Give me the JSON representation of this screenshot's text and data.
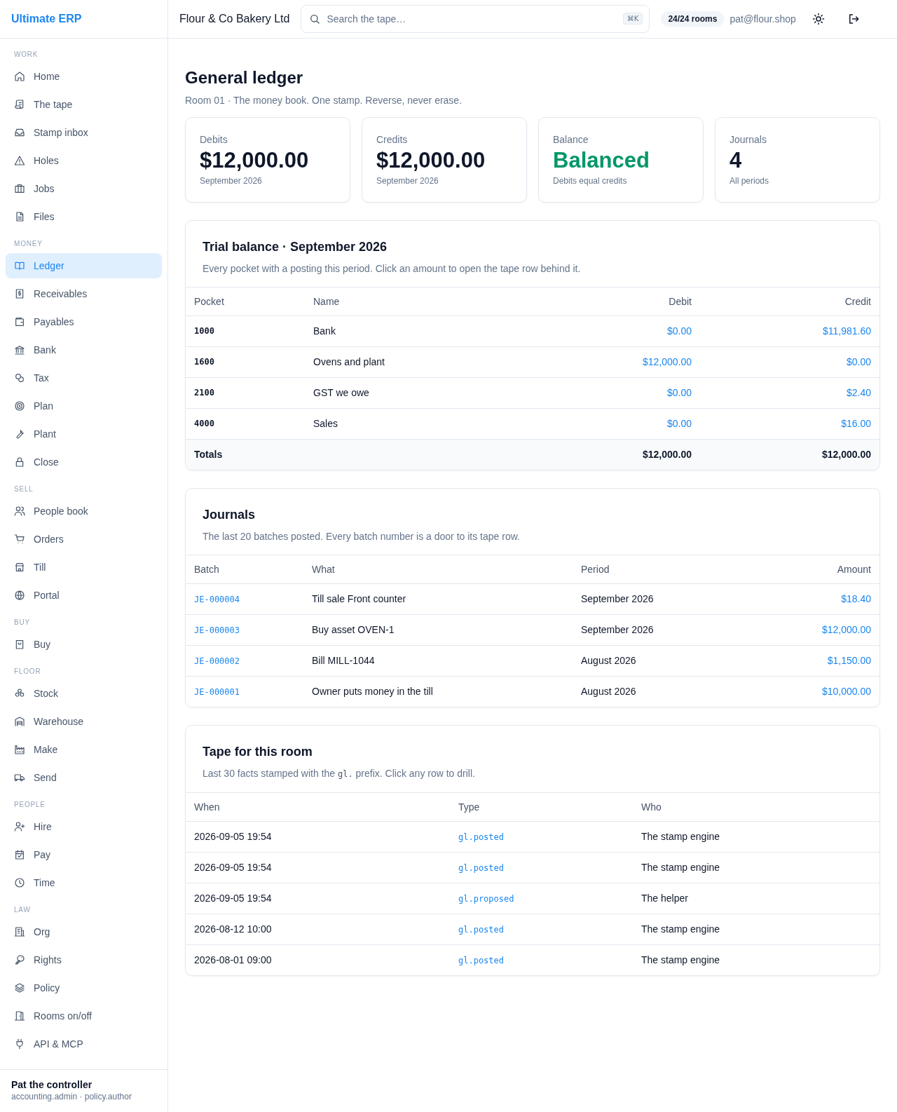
{
  "sidebar": {
    "brand": "Ultimate ERP",
    "sections": [
      {
        "label": "WORK",
        "items": [
          {
            "label": "Home",
            "selected": false
          },
          {
            "label": "The tape",
            "selected": false
          },
          {
            "label": "Stamp inbox",
            "selected": false
          },
          {
            "label": "Holes",
            "selected": false
          },
          {
            "label": "Jobs",
            "selected": false
          },
          {
            "label": "Files",
            "selected": false
          }
        ]
      },
      {
        "label": "MONEY",
        "items": [
          {
            "label": "Ledger",
            "selected": true
          },
          {
            "label": "Receivables",
            "selected": false
          },
          {
            "label": "Payables",
            "selected": false
          },
          {
            "label": "Bank",
            "selected": false
          },
          {
            "label": "Tax",
            "selected": false
          },
          {
            "label": "Plan",
            "selected": false
          },
          {
            "label": "Plant",
            "selected": false
          },
          {
            "label": "Close",
            "selected": false
          }
        ]
      },
      {
        "label": "SELL",
        "items": [
          {
            "label": "People book",
            "selected": false
          },
          {
            "label": "Orders",
            "selected": false
          },
          {
            "label": "Till",
            "selected": false
          },
          {
            "label": "Portal",
            "selected": false
          }
        ]
      },
      {
        "label": "BUY",
        "items": [
          {
            "label": "Buy",
            "selected": false
          }
        ]
      },
      {
        "label": "FLOOR",
        "items": [
          {
            "label": "Stock",
            "selected": false
          },
          {
            "label": "Warehouse",
            "selected": false
          },
          {
            "label": "Make",
            "selected": false
          },
          {
            "label": "Send",
            "selected": false
          }
        ]
      },
      {
        "label": "PEOPLE",
        "items": [
          {
            "label": "Hire",
            "selected": false
          },
          {
            "label": "Pay",
            "selected": false
          },
          {
            "label": "Time",
            "selected": false
          }
        ]
      },
      {
        "label": "LAW",
        "items": [
          {
            "label": "Org",
            "selected": false
          },
          {
            "label": "Rights",
            "selected": false
          },
          {
            "label": "Policy",
            "selected": false
          },
          {
            "label": "Rooms on/off",
            "selected": false
          },
          {
            "label": "API & MCP",
            "selected": false
          }
        ]
      }
    ],
    "user": {
      "name": "Pat the controller",
      "roles": "accounting.admin · policy.author"
    }
  },
  "topbar": {
    "org": "Flour & Co Bakery Ltd",
    "search": {
      "placeholder": "Search the tape…",
      "shortcut": "⌘K"
    },
    "rooms_badge": "24/24 rooms",
    "email": "pat@flour.shop"
  },
  "page": {
    "title": "General ledger",
    "subtitle": "Room 01 · The money book. One stamp. Reverse, never erase."
  },
  "stats": [
    {
      "label": "Debits",
      "value": "$12,000.00",
      "note": "September 2026",
      "kind": "plain"
    },
    {
      "label": "Credits",
      "value": "$12,000.00",
      "note": "September 2026",
      "kind": "plain"
    },
    {
      "label": "Balance",
      "value": "Balanced",
      "note": "Debits equal credits",
      "kind": "good"
    },
    {
      "label": "Journals",
      "value": "4",
      "note": "All periods",
      "kind": "plain"
    }
  ],
  "trial_balance": {
    "title": "Trial balance · September 2026",
    "description": "Every pocket with a posting this period. Click an amount to open the tape row behind it.",
    "columns": [
      "Pocket",
      "Name",
      "Debit",
      "Credit"
    ],
    "rows": [
      {
        "pocket": "1000",
        "name": "Bank",
        "debit": "$0.00",
        "credit": "$11,981.60"
      },
      {
        "pocket": "1600",
        "name": "Ovens and plant",
        "debit": "$12,000.00",
        "credit": "$0.00"
      },
      {
        "pocket": "2100",
        "name": "GST we owe",
        "debit": "$0.00",
        "credit": "$2.40"
      },
      {
        "pocket": "4000",
        "name": "Sales",
        "debit": "$0.00",
        "credit": "$16.00"
      }
    ],
    "totals": {
      "label": "Totals",
      "debit": "$12,000.00",
      "credit": "$12,000.00"
    }
  },
  "journals": {
    "title": "Journals",
    "description": "The last 20 batches posted. Every batch number is a door to its tape row.",
    "columns": [
      "Batch",
      "What",
      "Period",
      "Amount"
    ],
    "rows": [
      {
        "batch": "JE-000004",
        "what": "Till sale Front counter",
        "period": "September 2026",
        "amount": "$18.40"
      },
      {
        "batch": "JE-000003",
        "what": "Buy asset OVEN-1",
        "period": "September 2026",
        "amount": "$12,000.00"
      },
      {
        "batch": "JE-000002",
        "what": "Bill MILL-1044",
        "period": "August 2026",
        "amount": "$1,150.00"
      },
      {
        "batch": "JE-000001",
        "what": "Owner puts money in the till",
        "period": "August 2026",
        "amount": "$10,000.00"
      }
    ]
  },
  "tape": {
    "title": "Tape for this room",
    "description": [
      {
        "kind": "text",
        "text": "Last 30 facts stamped with the "
      },
      {
        "kind": "code",
        "text": "gl."
      },
      {
        "kind": "text",
        "text": " prefix. Click any row to drill."
      }
    ],
    "columns": [
      "When",
      "Type",
      "Who"
    ],
    "rows": [
      {
        "when": "2026-09-05 19:54",
        "type": "gl.posted",
        "who": "The stamp engine"
      },
      {
        "when": "2026-09-05 19:54",
        "type": "gl.posted",
        "who": "The stamp engine"
      },
      {
        "when": "2026-09-05 19:54",
        "type": "gl.proposed",
        "who": "The helper"
      },
      {
        "when": "2026-08-12 10:00",
        "type": "gl.posted",
        "who": "The stamp engine"
      },
      {
        "when": "2026-08-01 09:00",
        "type": "gl.posted",
        "who": "The stamp engine"
      }
    ]
  }
}
